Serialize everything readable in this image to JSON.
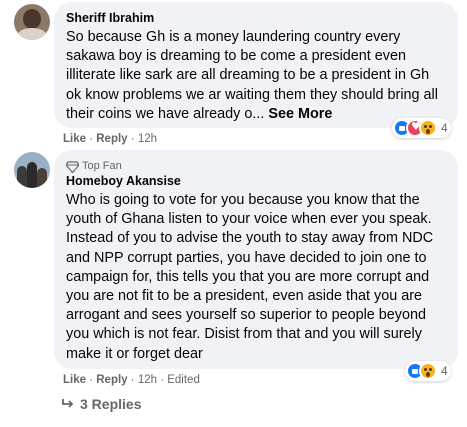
{
  "comments": [
    {
      "author": "Sheriff Ibrahim",
      "text": "So because Gh is a money laundering country every sakawa boy is dreaming to be come a president even illiterate like sark are all dreaming to be a president in Gh ok know problems we ar waiting them they should bring all their coins we have already o...",
      "see_more": "See More",
      "like_label": "Like",
      "reply_label": "Reply",
      "time": "12h",
      "separator": "·",
      "reaction_icons": [
        "like-icon",
        "love-icon",
        "wow-icon"
      ],
      "reaction_count": "4"
    },
    {
      "author": "Homeboy Akansise",
      "badge": "Top Fan",
      "text": "Who is going to vote for you because you know that the youth of Ghana listen to your voice when ever you speak. Instead of you to advise the youth to stay away from NDC and NPP corrupt parties, you have decided to join one to campaign for, this tells you that you are more corrupt and you are not fit to be a president, even aside that you are arrogant and sees yourself so superior to people beyond you which is not fear. Disist from that and you will surely make it or forget dear",
      "like_label": "Like",
      "reply_label": "Reply",
      "time": "12h",
      "edited": "Edited",
      "separator": "·",
      "reaction_icons": [
        "like-icon",
        "wow-icon"
      ],
      "reaction_count": "4",
      "replies_label": "3 Replies"
    }
  ],
  "colors": {
    "bubble": "#f0f2f5",
    "meta_text": "#65676b",
    "like": "#1877f2",
    "love": "#f33e58",
    "wow": "#f7b125"
  }
}
